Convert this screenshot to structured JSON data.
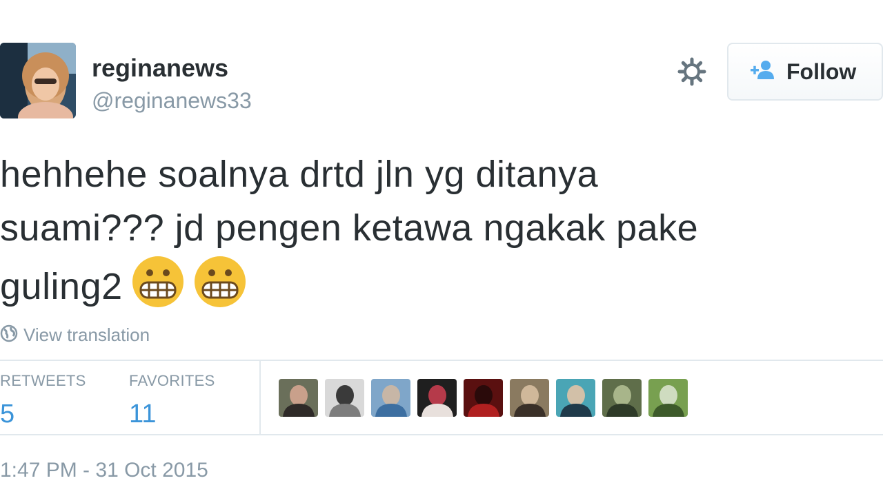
{
  "user": {
    "name": "reginanews",
    "handle": "@reginanews33"
  },
  "follow_button": {
    "label": "Follow",
    "icon": "add-user-icon"
  },
  "settings_icon": "gear-icon",
  "tweet": {
    "text_line1": "hehhehe soalnya drtd jln yg ditanya",
    "text_line2": "suami??? jd pengen ketawa ngakak pake",
    "text_line3": "guling2",
    "emojis": [
      "grimacing-face-emoji",
      "grimacing-face-emoji"
    ]
  },
  "translation": {
    "label": "View translation",
    "icon": "globe-icon"
  },
  "stats": {
    "retweets_label": "RETWEETS",
    "retweets_count": "5",
    "favorites_label": "FAVORITES",
    "favorites_count": "11"
  },
  "favoriters": [
    {
      "name": "favoriter-avatar-1",
      "colors": [
        "#6a6f5a",
        "#2e2a28",
        "#c9a08b"
      ]
    },
    {
      "name": "favoriter-avatar-2",
      "colors": [
        "#d9d9d9",
        "#7d7d7d",
        "#3a3a3a"
      ]
    },
    {
      "name": "favoriter-avatar-3",
      "colors": [
        "#7fa6c9",
        "#3d6fa1",
        "#c7b6a6"
      ]
    },
    {
      "name": "favoriter-avatar-4",
      "colors": [
        "#1f1f1f",
        "#e8e0dc",
        "#b53a4a"
      ]
    },
    {
      "name": "favoriter-avatar-5",
      "colors": [
        "#5a1010",
        "#b02020",
        "#2a0a0a"
      ]
    },
    {
      "name": "favoriter-avatar-6",
      "colors": [
        "#8a7a60",
        "#3a3028",
        "#d0b89a"
      ]
    },
    {
      "name": "favoriter-avatar-7",
      "colors": [
        "#4aa5b5",
        "#1f3a4a",
        "#d2c0a8"
      ]
    },
    {
      "name": "favoriter-avatar-8",
      "colors": [
        "#5f6e4a",
        "#2e3a28",
        "#a8b58a"
      ]
    },
    {
      "name": "favoriter-avatar-9",
      "colors": [
        "#78a050",
        "#3d5a2a",
        "#cfdcc0"
      ]
    }
  ],
  "timestamp": "1:47 PM - 31 Oct 2015",
  "colors": {
    "text": "#292f33",
    "muted": "#8899a6",
    "link": "#3b94d9",
    "border": "#e1e8ed",
    "emoji": "#f6c338"
  }
}
